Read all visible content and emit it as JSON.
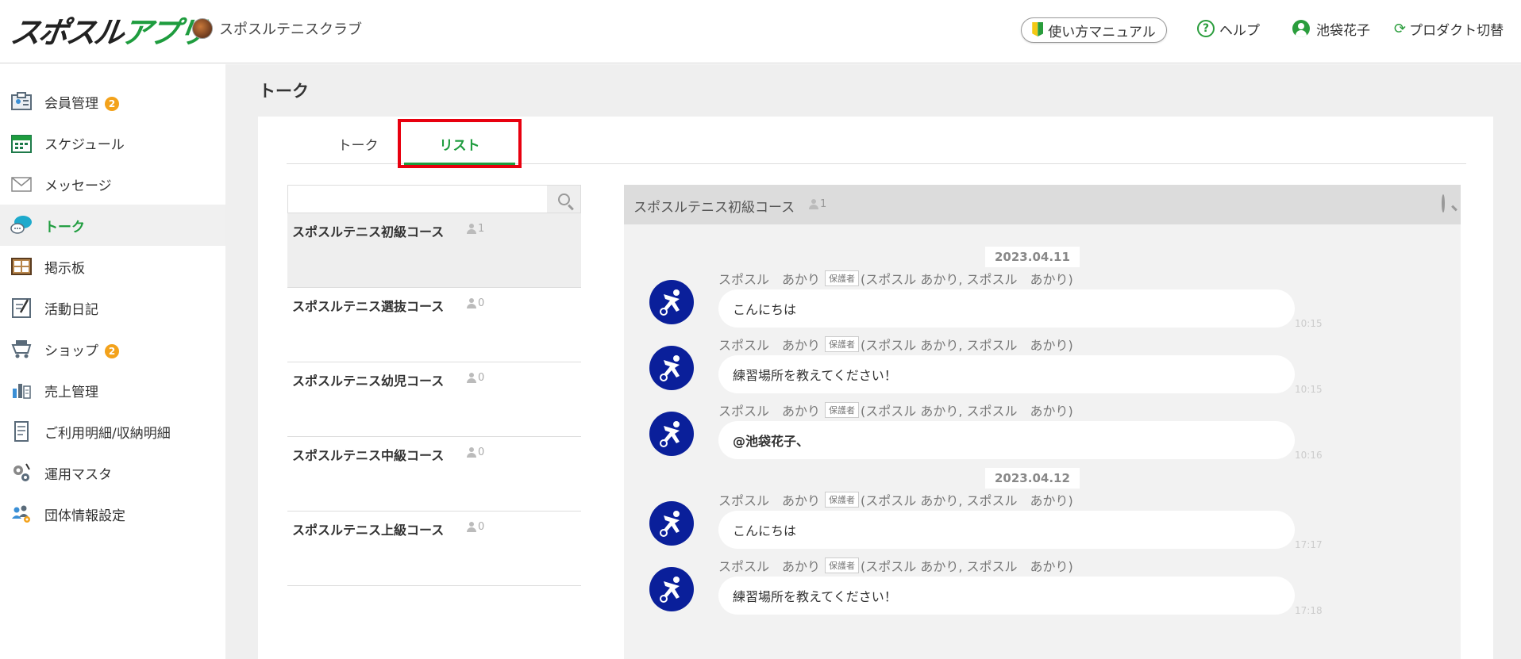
{
  "header": {
    "logo_dark": "スポスル",
    "logo_green": "アプリ",
    "club_name": "スポスルテニスクラブ",
    "manual_label": "使い方マニュアル",
    "help_label": "ヘルプ",
    "user_name": "池袋花子",
    "product_switch_label": "プロダクト切替"
  },
  "sidebar": {
    "items": [
      {
        "label": "会員管理",
        "badge": "2",
        "icon": "member-icon"
      },
      {
        "label": "スケジュール",
        "icon": "calendar-icon"
      },
      {
        "label": "メッセージ",
        "icon": "envelope-icon"
      },
      {
        "label": "トーク",
        "icon": "chat-icon",
        "active": true
      },
      {
        "label": "掲示板",
        "icon": "bulletin-board-icon"
      },
      {
        "label": "活動日記",
        "icon": "diary-icon"
      },
      {
        "label": "ショップ",
        "badge": "2",
        "icon": "cart-icon"
      },
      {
        "label": "売上管理",
        "icon": "sales-icon"
      },
      {
        "label": "ご利用明細/収納明細",
        "icon": "receipt-icon"
      },
      {
        "label": "運用マスタ",
        "icon": "gear-icon"
      },
      {
        "label": "団体情報設定",
        "icon": "group-settings-icon"
      }
    ]
  },
  "page": {
    "title": "トーク",
    "tabs": [
      {
        "label": "トーク"
      },
      {
        "label": "リスト",
        "active": true
      }
    ]
  },
  "rooms": [
    {
      "name": "スポスルテニス初級コース",
      "count": "1",
      "selected": true
    },
    {
      "name": "スポスルテニス選抜コース",
      "count": "0"
    },
    {
      "name": "スポスルテニス幼児コース",
      "count": "0"
    },
    {
      "name": "スポスルテニス中級コース",
      "count": "0"
    },
    {
      "name": "スポスルテニス上級コース",
      "count": "0"
    }
  ],
  "chat": {
    "title": "スポスルテニス初級コース",
    "count": "1",
    "dates": [
      "2023.04.11",
      "2023.04.12"
    ],
    "messages": [
      {
        "sender": "スポスル　あかり",
        "role": "保護者",
        "detail": "(スポスル あかり, スポスル　あかり)",
        "text": "こんにちは",
        "time": "10:15"
      },
      {
        "sender": "スポスル　あかり",
        "role": "保護者",
        "detail": "(スポスル あかり, スポスル　あかり)",
        "text": "練習場所を教えてください！",
        "time": "10:15"
      },
      {
        "sender": "スポスル　あかり",
        "role": "保護者",
        "detail": "(スポスル あかり, スポスル　あかり)",
        "text": "@池袋花子、",
        "time": "10:16"
      },
      {
        "sender": "スポスル　あかり",
        "role": "保護者",
        "detail": "(スポスル あかり, スポスル　あかり)",
        "text": "こんにちは",
        "time": "17:17"
      },
      {
        "sender": "スポスル　あかり",
        "role": "保護者",
        "detail": "(スポスル あかり, スポスル　あかり)",
        "text": "練習場所を教えてください！",
        "time": "17:18"
      }
    ]
  },
  "colors": {
    "accent": "#1e9c3e",
    "badge": "#f3a21b",
    "highlight": "#e8000f",
    "avatar": "#0a1f9a"
  }
}
